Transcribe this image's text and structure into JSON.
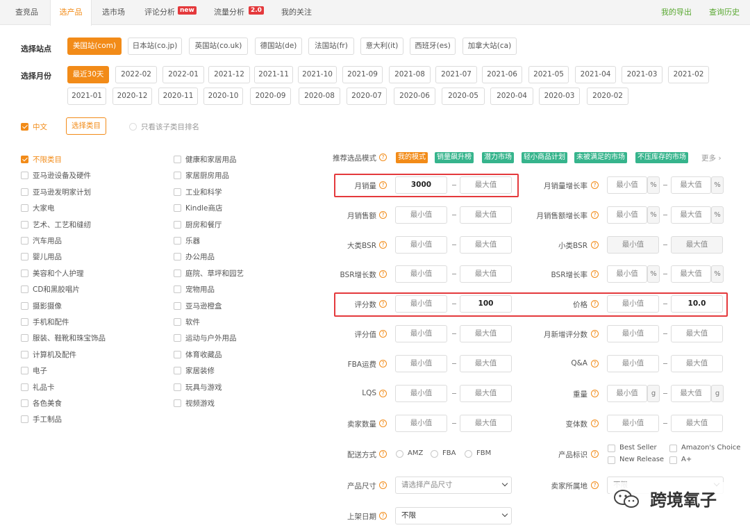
{
  "tabs": [
    {
      "label": "查竞品"
    },
    {
      "label": "选产品"
    },
    {
      "label": "选市场"
    },
    {
      "label": "评论分析",
      "badge": "new"
    },
    {
      "label": "流量分析",
      "badge": "2.0"
    },
    {
      "label": "我的关注"
    }
  ],
  "top_links": {
    "export": "我的导出",
    "history": "查询历史"
  },
  "site": {
    "label": "选择站点",
    "options": [
      "美国站(com)",
      "日本站(co.jp)",
      "英国站(co.uk)",
      "德国站(de)",
      "法国站(fr)",
      "意大利(it)",
      "西班牙(es)",
      "加拿大站(ca)"
    ],
    "selected": "美国站(com)"
  },
  "month": {
    "label": "选择月份",
    "row1": [
      "最近30天",
      "2022-02",
      "2022-01",
      "2021-12",
      "2021-11",
      "2021-10",
      "2021-09",
      "2021-08",
      "2021-07",
      "2021-06",
      "2021-05",
      "2021-04",
      "2021-03",
      "2021-02"
    ],
    "row2": [
      "2021-01",
      "2020-12",
      "2020-11",
      "2020-10",
      "2020-09",
      "2020-08",
      "2020-07",
      "2020-06",
      "2020-05",
      "2020-04",
      "2020-03",
      "2020-02"
    ],
    "selected": "最近30天"
  },
  "lang": {
    "chinese": "中文",
    "choose_category": "选择类目",
    "only_sub": "只看该子类目排名"
  },
  "categories_left": [
    "不限类目",
    "亚马逊设备及硬件",
    "亚马逊发明家计划",
    "大家电",
    "艺术、工艺和缝纫",
    "汽车用品",
    "婴儿用品",
    "美容和个人护理",
    "CD和黑胶唱片",
    "摄影摄像",
    "手机和配件",
    "服装、鞋靴和珠宝饰品",
    "计算机及配件",
    "电子",
    "礼品卡",
    "各色美食",
    "手工制品"
  ],
  "categories_right": [
    "健康和家居用品",
    "家居厨房用品",
    "工业和科学",
    "Kindle商店",
    "厨房和餐厅",
    "乐器",
    "办公用品",
    "庭院、草坪和园艺",
    "宠物用品",
    "亚马逊橙盒",
    "软件",
    "运动与户外用品",
    "体育收藏品",
    "家居装修",
    "玩具与游戏",
    "视频游戏"
  ],
  "mode": {
    "label": "推荐选品模式",
    "options": [
      "我的模式",
      "销量飙升榜",
      "潜力市场",
      "轻小商品计划",
      "未被满足的市场",
      "不压库存的市场"
    ],
    "more": "更多"
  },
  "placeholders": {
    "min": "最小值",
    "max": "最大值"
  },
  "filters_left": [
    {
      "label": "月销量",
      "min": "3000",
      "max": ""
    },
    {
      "label": "月销售额",
      "min": "",
      "max": ""
    },
    {
      "label": "大类BSR",
      "min": "",
      "max": ""
    },
    {
      "label": "BSR增长数",
      "min": "",
      "max": ""
    },
    {
      "label": "评分数",
      "min": "",
      "max": "100"
    },
    {
      "label": "评分值",
      "min": "",
      "max": ""
    },
    {
      "label": "FBA运费",
      "min": "",
      "max": ""
    },
    {
      "label": "LQS",
      "min": "",
      "max": ""
    },
    {
      "label": "卖家数量",
      "min": "",
      "max": ""
    }
  ],
  "filters_right": [
    {
      "label": "月销量增长率",
      "min": "",
      "max": "",
      "unit": "%"
    },
    {
      "label": "月销售额增长率",
      "min": "",
      "max": "",
      "unit": "%"
    },
    {
      "label": "小类BSR",
      "min": "",
      "max": "",
      "unit": ""
    },
    {
      "label": "BSR增长率",
      "min": "",
      "max": "",
      "unit": "%"
    },
    {
      "label": "价格",
      "min": "",
      "max": "10.0",
      "unit": ""
    },
    {
      "label": "月新增评分数",
      "min": "",
      "max": "",
      "unit": ""
    },
    {
      "label": "Q&A",
      "min": "",
      "max": "",
      "unit": ""
    },
    {
      "label": "重量",
      "min": "",
      "max": "",
      "unit": "g"
    },
    {
      "label": "变体数",
      "min": "",
      "max": "",
      "unit": ""
    }
  ],
  "delivery": {
    "label": "配送方式",
    "options": [
      "AMZ",
      "FBA",
      "FBM"
    ]
  },
  "product_tag": {
    "label": "产品标识",
    "options": [
      "Best Seller",
      "Amazon's Choice",
      "New Release",
      "A+"
    ]
  },
  "size": {
    "label": "产品尺寸",
    "value": "请选择产品尺寸"
  },
  "seller_loc": {
    "label": "卖家所属地",
    "value": "不限"
  },
  "listed": {
    "label": "上架日期",
    "value": "不限"
  },
  "watermark": "跨境氧子"
}
